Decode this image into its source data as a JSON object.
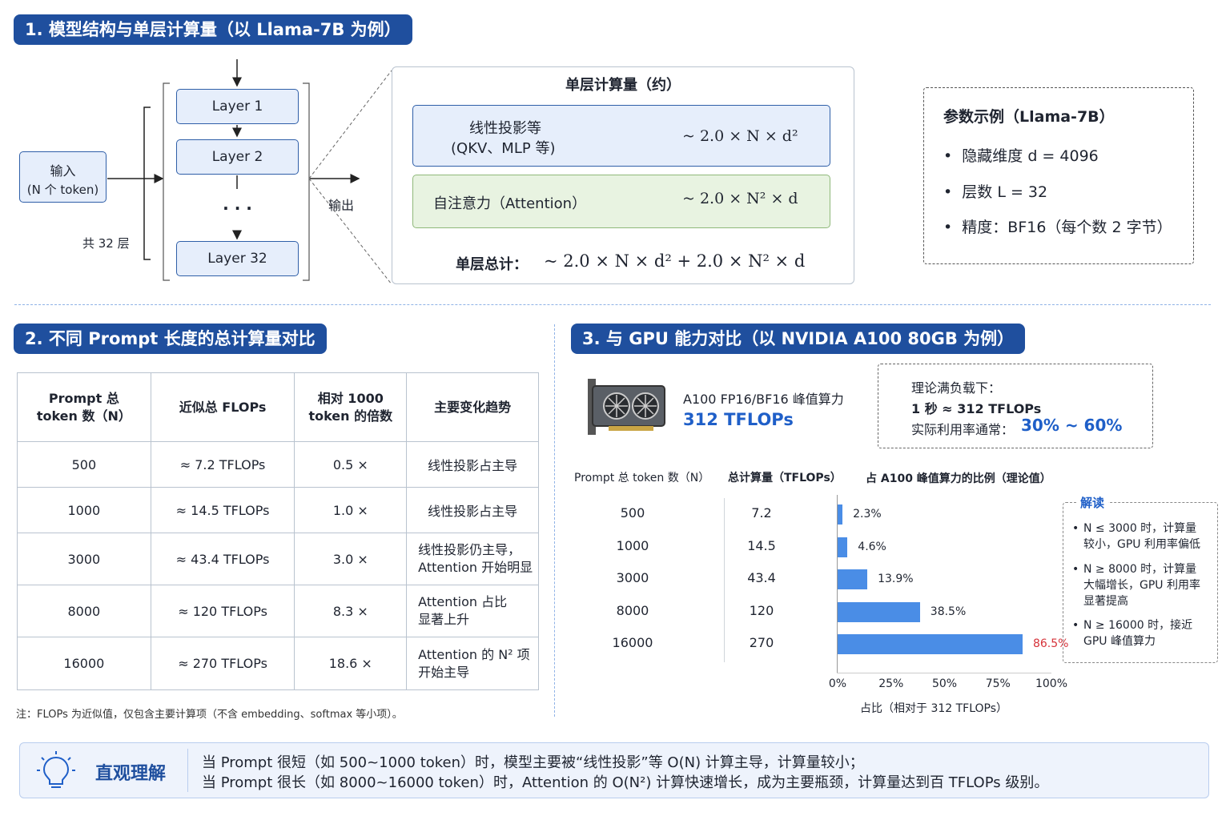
{
  "section1": {
    "title": "1. 模型结构与单层计算量（以 Llama-7B 为例）",
    "input_line1": "输入",
    "input_line2": "(N 个 token)",
    "layers": [
      "Layer 1",
      "Layer 2",
      "· · ·",
      "Layer 32"
    ],
    "total_layers": "共 32 层",
    "output": "输出",
    "calc_title": "单层计算量（约）",
    "linear_line1": "线性投影等",
    "linear_line2": "(QKV、MLP 等)",
    "linear_formula": "~ 2.0 × N × d²",
    "attn_label": "自注意力（Attention）",
    "attn_formula": "~ 2.0 × N² × d",
    "total_label": "单层总计：",
    "total_formula": "~ 2.0 × N × d² + 2.0 × N² × d",
    "params_title": "参数示例（Llama-7B）",
    "params": [
      "隐藏维度  d = 4096",
      "层数  L = 32",
      "精度：BF16（每个数 2 字节）"
    ]
  },
  "section2": {
    "title": "2. 不同 Prompt 长度的总计算量对比",
    "headers": [
      "Prompt 总\ntoken 数（N）",
      "近似总 FLOPs",
      "相对 1000\ntoken 的倍数",
      "主要变化趋势"
    ],
    "rows": [
      [
        "500",
        "≈  7.2 TFLOPs",
        "0.5 ×",
        "线性投影占主导"
      ],
      [
        "1000",
        "≈  14.5 TFLOPs",
        "1.0 ×",
        "线性投影占主导"
      ],
      [
        "3000",
        "≈  43.4 TFLOPs",
        "3.0 ×",
        "线性投影仍主导，\nAttention 开始明显"
      ],
      [
        "8000",
        "≈  120 TFLOPs",
        "8.3 ×",
        "Attention 占比\n显著上升"
      ],
      [
        "16000",
        "≈  270 TFLOPs",
        "18.6 ×",
        "Attention 的 N² 项\n开始主导"
      ]
    ],
    "footnote": "注：FLOPs 为近似值，仅包含主要计算项（不含 embedding、softmax 等小项）。"
  },
  "section3": {
    "title": "3. 与 GPU 能力对比（以 NVIDIA A100 80GB 为例）",
    "gpu_label": "A100 FP16/BF16 峰值算力",
    "gpu_value": "312 TFLOPs",
    "theory_line1": "理论满负载下：",
    "theory_line2": "1 秒 ≈ 312 TFLOPs",
    "util_label": "实际利用率通常：",
    "util_value": "30% ~ 60%",
    "col_headers": [
      "Prompt 总 token 数（N）",
      "总计算量（TFLOPs）",
      "占 A100 峰值算力的比例（理论值）"
    ],
    "note_title": "解读",
    "notes": [
      "N ≤ 3000 时，计算量\n较小，GPU 利用率偏低",
      "N ≥ 8000 时，计算量\n大幅增长，GPU 利用率\n显著提高",
      "N ≥ 16000 时，接近\nGPU 峰值算力"
    ]
  },
  "chart_data": {
    "type": "bar",
    "orientation": "horizontal",
    "categories": [
      "500",
      "1000",
      "3000",
      "8000",
      "16000"
    ],
    "compute_tflops": [
      "7.2",
      "14.5",
      "43.4",
      "120",
      "270"
    ],
    "values": [
      2.3,
      4.6,
      13.9,
      38.5,
      86.5
    ],
    "value_labels": [
      "2.3%",
      "4.6%",
      "13.9%",
      "38.5%",
      "86.5%"
    ],
    "xticks": [
      "0%",
      "25%",
      "50%",
      "75%",
      "100%"
    ],
    "xlim": [
      0,
      100
    ],
    "xlabel": "占比（相对于 312 TFLOPs）",
    "bar_color": "#4a8de6",
    "highlight_color": "#d6333a"
  },
  "insight": {
    "title": "直观理解",
    "line1": "当 Prompt 很短（如 500~1000 token）时，模型主要被“线性投影”等 O(N) 计算主导，计算量较小；",
    "line2": "当 Prompt 很长（如 8000~16000 token）时，Attention 的 O(N²) 计算快速增长，成为主要瓶颈，计算量达到百 TFLOPs 级别。"
  },
  "colors": {
    "header_bg": "#1f4f9e",
    "accent": "#1f5fc8",
    "linear_bg": "#e6eefb",
    "attn_bg": "#e8f3e1"
  }
}
